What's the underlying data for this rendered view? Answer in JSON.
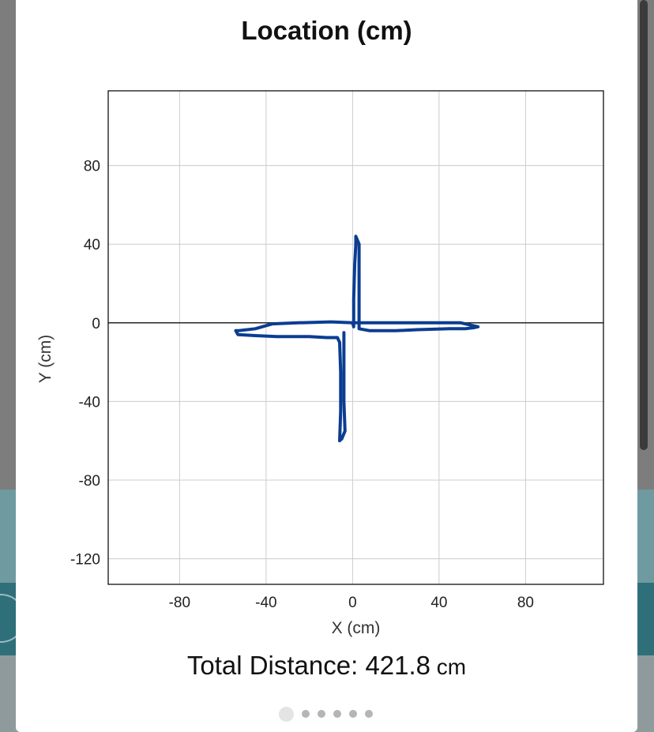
{
  "chart_data": {
    "type": "line",
    "title": "Location (cm)",
    "xlabel": "X (cm)",
    "ylabel": "Y (cm)",
    "xlim": [
      -113,
      116
    ],
    "ylim": [
      -133,
      118
    ],
    "xticks": [
      -80,
      -40,
      0,
      40,
      80
    ],
    "yticks": [
      80,
      40,
      0,
      -40,
      -80,
      -120
    ],
    "grid": true,
    "zero_line": true,
    "series": [
      {
        "color": "#0b3d91",
        "points": [
          [
            0,
            0
          ],
          [
            -10,
            0.5
          ],
          [
            -25,
            0
          ],
          [
            -37,
            -0.5
          ],
          [
            -45,
            -3
          ],
          [
            -53,
            -4
          ],
          [
            -54,
            -4
          ],
          [
            -53,
            -6
          ],
          [
            -45,
            -6.5
          ],
          [
            -35,
            -7
          ],
          [
            -20,
            -7
          ],
          [
            -12,
            -7.5
          ],
          [
            -7,
            -7.5
          ],
          [
            -6,
            -10
          ],
          [
            -5.5,
            -25
          ],
          [
            -5.5,
            -45
          ],
          [
            -6,
            -60
          ],
          [
            -5,
            -59
          ],
          [
            -3.5,
            -55
          ],
          [
            -4,
            -40
          ],
          [
            -4,
            -20
          ],
          [
            -4,
            -5
          ]
        ]
      },
      {
        "color": "#0b3d91",
        "points": [
          [
            0,
            0
          ],
          [
            0.5,
            -2
          ],
          [
            0.5,
            12
          ],
          [
            1,
            30
          ],
          [
            1.5,
            40
          ],
          [
            1.5,
            44
          ],
          [
            3,
            40
          ],
          [
            3,
            20
          ],
          [
            3,
            -3
          ],
          [
            8,
            -4
          ],
          [
            20,
            -4
          ],
          [
            30,
            -3.5
          ],
          [
            45,
            -3
          ],
          [
            52,
            -3
          ],
          [
            56,
            -2.5
          ],
          [
            58,
            -2
          ],
          [
            54,
            -1
          ],
          [
            50,
            0
          ],
          [
            30,
            0
          ],
          [
            10,
            0
          ],
          [
            0,
            0
          ]
        ]
      }
    ]
  },
  "footer": {
    "total_label": "Total Distance: 421.8",
    "total_unit": " cm"
  },
  "pager": {
    "count": 6,
    "active": 0
  }
}
